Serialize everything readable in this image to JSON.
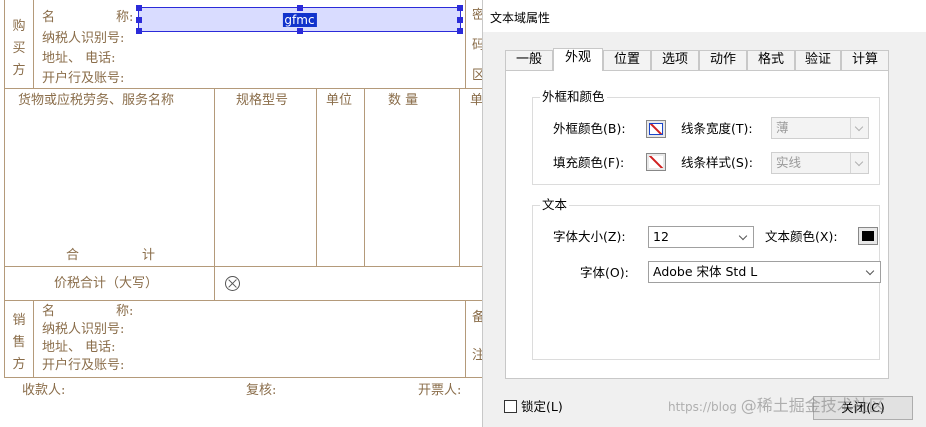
{
  "invoice": {
    "buyer_side": [
      "购",
      "买",
      "方"
    ],
    "buyer_fields": {
      "name_a": "名",
      "name_b": "称:",
      "taxpayer_id": "纳税人识别号:",
      "address": "地址、 电话:",
      "bank": "开户行及账号:"
    },
    "secret_col": [
      "密",
      "码",
      "区"
    ],
    "form_field_name": "gfmc",
    "goods_header": {
      "goods": "货物或应税劳务、服务名称",
      "spec": "规格型号",
      "unit": "单位",
      "qty": "数 量",
      "price_partial": "单"
    },
    "total_label_a": "合",
    "total_label_b": "计",
    "tax_total_label": "价税合计（大写）",
    "seller_side": [
      "销",
      "售",
      "方"
    ],
    "seller_fields": {
      "name_a": "名",
      "name_b": "称:",
      "taxpayer_id": "纳税人识别号:",
      "address": "地址、 电话:",
      "bank": "开户行及账号:"
    },
    "remark_col": [
      "备",
      "注"
    ],
    "footer": {
      "payee": "收款人:",
      "reviewer": "复核:",
      "drawer": "开票人:"
    }
  },
  "dialog": {
    "title": "文本域属性",
    "tabs": [
      "一般",
      "外观",
      "位置",
      "选项",
      "动作",
      "格式",
      "验证",
      "计算"
    ],
    "active_tab": "外观",
    "border_group": {
      "title": "外框和颜色",
      "border_color_label": "外框颜色(B):",
      "border_color_key": "B",
      "fill_color_label": "填充颜色(F):",
      "fill_color_key": "F",
      "line_width_label": "线条宽度(T):",
      "line_width_key": "T",
      "line_width_value": "薄",
      "line_style_label": "线条样式(S):",
      "line_style_key": "S",
      "line_style_value": "实线"
    },
    "text_group": {
      "title": "文本",
      "font_size_label": "字体大小(Z):",
      "font_size_key": "Z",
      "font_size_value": "12",
      "text_color_label": "文本颜色(X):",
      "text_color_key": "X",
      "text_color": "#000000",
      "font_label": "字体(O):",
      "font_key": "O",
      "font_value": "Adobe 宋体 Std L"
    },
    "lock_label": "锁定(L)",
    "close_label": "关闭(C)"
  },
  "watermark": {
    "url": "https://blog",
    "brand": "@稀土掘金技术社区"
  },
  "colors": {
    "invoice_line": "#b49a7a",
    "invoice_text": "#8a6d4a",
    "field_border": "#2b2bd9",
    "field_fill": "#d9dcff"
  }
}
